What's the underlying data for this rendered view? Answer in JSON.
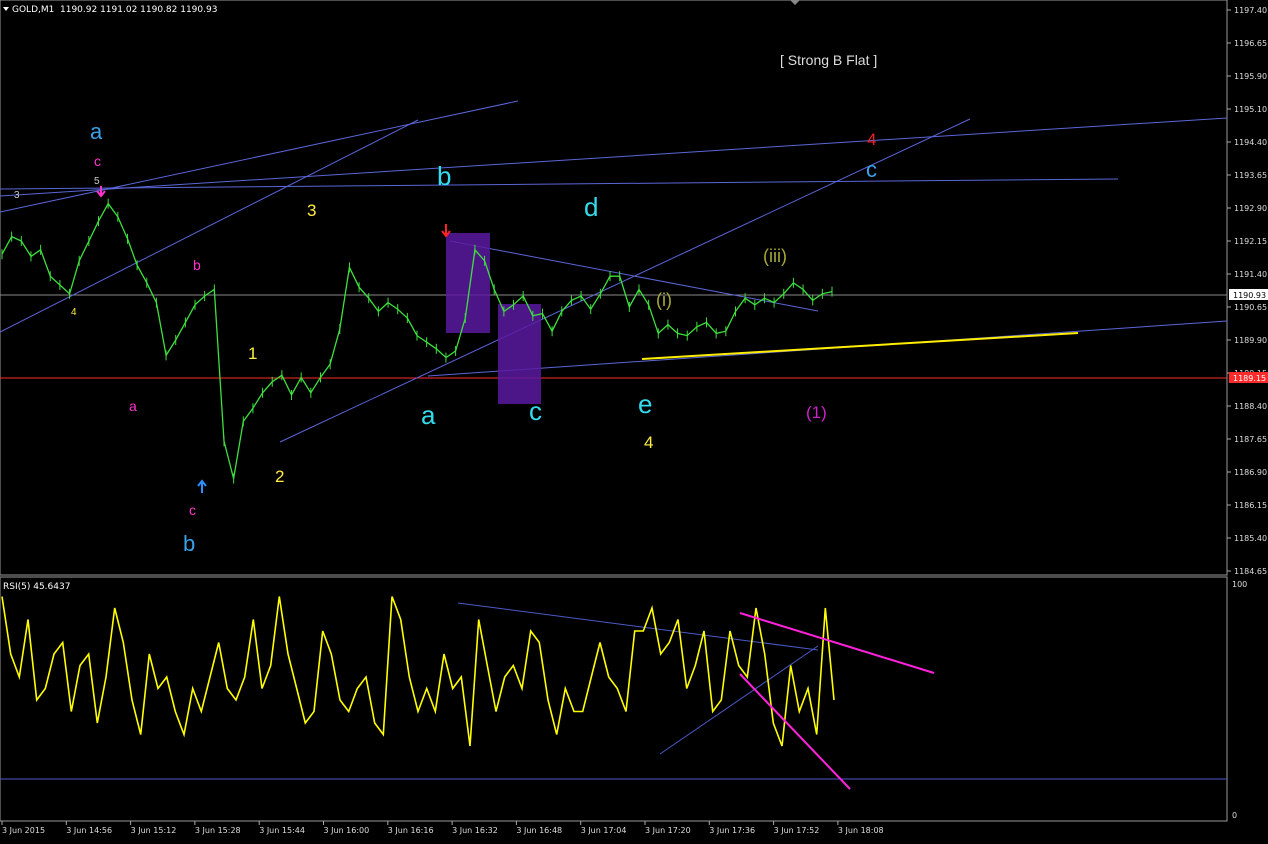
{
  "header": {
    "symbol": "GOLD,M1",
    "ohlc": "1190.92 1191.02 1190.82 1190.93"
  },
  "price_axis": {
    "ticks": [
      "1197.40",
      "1196.65",
      "1195.90",
      "1195.10",
      "1194.40",
      "1193.65",
      "1192.90",
      "1192.15",
      "1191.40",
      "1190.65",
      "1189.90",
      "1189.15",
      "1188.40",
      "1187.65",
      "1186.90",
      "1186.15",
      "1185.40",
      "1184.65"
    ],
    "current_price": "1190.93",
    "ref_price": "1189.15"
  },
  "rsi_panel": {
    "label": "RSI(5) 45.6437",
    "max_label": "100",
    "min_label": "0"
  },
  "time_axis": [
    "3 Jun 2015",
    "3 Jun 14:56",
    "3 Jun 15:12",
    "3 Jun 15:28",
    "3 Jun 15:44",
    "3 Jun 16:00",
    "3 Jun 16:16",
    "3 Jun 16:32",
    "3 Jun 16:48",
    "3 Jun 17:04",
    "3 Jun 17:20",
    "3 Jun 17:36",
    "3 Jun 17:52",
    "3 Jun 18:08"
  ],
  "annotation_title": "[ Strong B Flat ]",
  "wave_labels": [
    {
      "text": "a",
      "color": "#3aa0e8"
    },
    {
      "text": "c",
      "color": "#ff33cc"
    },
    {
      "text": "5",
      "color": "#cccccc"
    },
    {
      "text": "3",
      "color": "#cccccc"
    },
    {
      "text": "4",
      "color": "#ffee44"
    },
    {
      "text": "b",
      "color": "#ff33cc"
    },
    {
      "text": "a",
      "color": "#ff33cc"
    },
    {
      "text": "c",
      "color": "#ff33cc"
    },
    {
      "text": "b",
      "color": "#3aa0e8"
    },
    {
      "text": "1",
      "color": "#ffee44"
    },
    {
      "text": "2",
      "color": "#ffee44"
    },
    {
      "text": "3",
      "color": "#ffee44"
    },
    {
      "text": "b",
      "color": "#33ddee"
    },
    {
      "text": "a",
      "color": "#33ddee"
    },
    {
      "text": "c",
      "color": "#33ddee"
    },
    {
      "text": "d",
      "color": "#33ddee"
    },
    {
      "text": "e",
      "color": "#33ddee"
    },
    {
      "text": "4",
      "color": "#ffee44"
    },
    {
      "text": "(i)",
      "color": "#a8a838"
    },
    {
      "text": "(iii)",
      "color": "#a8a838"
    },
    {
      "text": "4",
      "color": "#ee2222"
    },
    {
      "text": "c",
      "color": "#3aa0e8"
    },
    {
      "text": "(1)",
      "color": "#cc22cc"
    }
  ],
  "chart_data": {
    "type": "line",
    "title": "",
    "series": [
      {
        "values": [
          1191.85,
          1192.25,
          1192.15,
          1191.8,
          1191.95,
          1191.35,
          1191.15,
          1190.95,
          1191.7,
          1192.15,
          1192.6,
          1193.0,
          1192.7,
          1192.2,
          1191.6,
          1191.2,
          1190.75,
          1189.55,
          1189.9,
          1190.3,
          1190.7,
          1190.9,
          1191.05,
          1187.6,
          1186.75,
          1188.05,
          1188.35,
          1188.7,
          1188.95,
          1189.1,
          1188.65,
          1189.05,
          1188.7,
          1189.05,
          1189.35,
          1190.15,
          1191.55,
          1191.1,
          1190.85,
          1190.55,
          1190.75,
          1190.6,
          1190.4,
          1190.0,
          1189.85,
          1189.7,
          1189.5,
          1189.65,
          1190.4,
          1191.95,
          1191.7,
          1191.05,
          1190.55,
          1190.7,
          1190.9,
          1190.45,
          1190.5,
          1190.1,
          1190.55,
          1190.8,
          1190.9,
          1190.6,
          1190.95,
          1191.35,
          1191.35,
          1190.65,
          1191.05,
          1190.7,
          1190.05,
          1190.25,
          1190.05,
          1190.0,
          1190.2,
          1190.3,
          1190.05,
          1190.1,
          1190.55,
          1190.85,
          1190.7,
          1190.85,
          1190.75,
          1190.95,
          1191.2,
          1191.05,
          1190.8,
          1190.95,
          1191.0
        ],
        "color": "#3ee03e"
      },
      {
        "values": [
          95,
          70,
          60,
          85,
          50,
          55,
          70,
          75,
          45,
          65,
          70,
          40,
          60,
          90,
          75,
          50,
          35,
          70,
          55,
          60,
          45,
          35,
          55,
          45,
          60,
          75,
          55,
          50,
          60,
          85,
          55,
          65,
          95,
          70,
          55,
          40,
          45,
          80,
          70,
          50,
          45,
          55,
          60,
          40,
          35,
          95,
          85,
          60,
          45,
          55,
          45,
          70,
          55,
          60,
          30,
          85,
          65,
          45,
          60,
          65,
          55,
          80,
          75,
          50,
          35,
          55,
          45,
          45,
          60,
          75,
          60,
          55,
          45,
          80,
          80,
          90,
          70,
          75,
          85,
          55,
          65,
          80,
          45,
          50,
          80,
          65,
          60,
          90,
          70,
          40,
          30,
          65,
          45,
          55,
          35,
          90,
          50
        ],
        "color": "#ffff00"
      }
    ]
  }
}
